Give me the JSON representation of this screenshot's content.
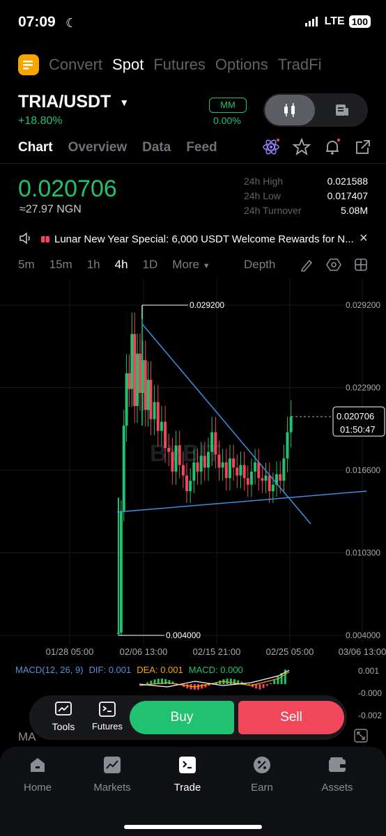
{
  "status_bar": {
    "time": "07:09",
    "network": "LTE",
    "battery": "100"
  },
  "top_nav": {
    "items": [
      "Convert",
      "Spot",
      "Futures",
      "Options",
      "TradFi"
    ],
    "active": "Spot"
  },
  "pair": {
    "symbol": "TRIA/USDT",
    "change": "+18.80%"
  },
  "mm": {
    "label": "MM",
    "value": "0.00%"
  },
  "tabs": {
    "items": [
      "Chart",
      "Overview",
      "Data",
      "Feed"
    ],
    "active": "Chart"
  },
  "price": {
    "last": "0.020706",
    "fiat": "≈27.97 NGN"
  },
  "stats": {
    "high_label": "24h High",
    "high": "0.021588",
    "low_label": "24h Low",
    "low": "0.017407",
    "turnover_label": "24h Turnover",
    "turnover": "5.08M"
  },
  "banner": {
    "text": "Lunar New Year Special: 6,000 USDT Welcome Rewards for N..."
  },
  "intervals": {
    "items": [
      "5m",
      "15m",
      "1h",
      "4h",
      "1D",
      "More"
    ],
    "active": "4h",
    "depth": "Depth"
  },
  "chart_data": {
    "type": "candlestick",
    "pair": "TRIA/USDT",
    "interval": "4h",
    "y_ticks": [
      "0.029200",
      "0.022900",
      "0.016600",
      "0.010300",
      "0.004000"
    ],
    "x_ticks": [
      "01/28 05:00",
      "02/06 13:00",
      "02/15 21:00",
      "02/25 05:00",
      "03/06 13:00"
    ],
    "high_marker": "0.029200",
    "low_marker": "0.004000",
    "last_price": "0.020706",
    "countdown": "01:50:47",
    "accent_colors": {
      "up": "#20c26f",
      "down": "#f0475a",
      "trendline": "#3d8fe0"
    },
    "ylim": [
      0.004,
      0.0292
    ],
    "close_path": [
      [
        0.0,
        0.0042
      ],
      [
        0.3,
        0.0135
      ],
      [
        0.6,
        0.02
      ],
      [
        0.9,
        0.024
      ],
      [
        1.2,
        0.0228
      ],
      [
        1.5,
        0.027
      ],
      [
        1.8,
        0.0215
      ],
      [
        2.1,
        0.0255
      ],
      [
        2.4,
        0.0225
      ],
      [
        2.7,
        0.025
      ],
      [
        3.0,
        0.0212
      ],
      [
        3.3,
        0.0235
      ],
      [
        3.6,
        0.0205
      ],
      [
        4.0,
        0.0218
      ],
      [
        4.4,
        0.0196
      ],
      [
        4.8,
        0.0203
      ],
      [
        5.2,
        0.0183
      ],
      [
        5.6,
        0.018
      ],
      [
        6.0,
        0.0165
      ],
      [
        6.4,
        0.0185
      ],
      [
        6.8,
        0.017
      ],
      [
        7.2,
        0.0162
      ],
      [
        7.6,
        0.015
      ],
      [
        8.0,
        0.0158
      ],
      [
        8.4,
        0.0172
      ],
      [
        8.8,
        0.0165
      ],
      [
        9.2,
        0.0177
      ],
      [
        9.6,
        0.0168
      ],
      [
        10.0,
        0.018
      ],
      [
        10.4,
        0.0195
      ],
      [
        10.8,
        0.0178
      ],
      [
        11.2,
        0.0168
      ],
      [
        11.6,
        0.0172
      ],
      [
        12.0,
        0.016
      ],
      [
        12.4,
        0.0175
      ],
      [
        12.8,
        0.0168
      ],
      [
        13.2,
        0.0162
      ],
      [
        13.6,
        0.017
      ],
      [
        14.0,
        0.016
      ],
      [
        14.4,
        0.0155
      ],
      [
        14.8,
        0.0165
      ],
      [
        15.2,
        0.0172
      ],
      [
        15.6,
        0.016
      ],
      [
        16.0,
        0.0158
      ],
      [
        16.4,
        0.0162
      ],
      [
        16.8,
        0.015
      ],
      [
        17.2,
        0.0155
      ],
      [
        17.6,
        0.0163
      ],
      [
        18.0,
        0.0158
      ],
      [
        18.4,
        0.0175
      ],
      [
        18.8,
        0.0195
      ],
      [
        19.2,
        0.0207
      ]
    ]
  },
  "macd": {
    "label": "MACD(12, 26, 9)",
    "dif": "DIF: 0.001",
    "dea": "DEA: 0.001",
    "macd": "MACD: 0.000",
    "ticks": [
      "0.001",
      "-0.000",
      "-0.002"
    ]
  },
  "actions": {
    "tools": "Tools",
    "futures": "Futures",
    "buy": "Buy",
    "sell": "Sell"
  },
  "ma_label": "MA",
  "bottom_nav": {
    "items": [
      "Home",
      "Markets",
      "Trade",
      "Earn",
      "Assets"
    ],
    "active": "Trade"
  }
}
